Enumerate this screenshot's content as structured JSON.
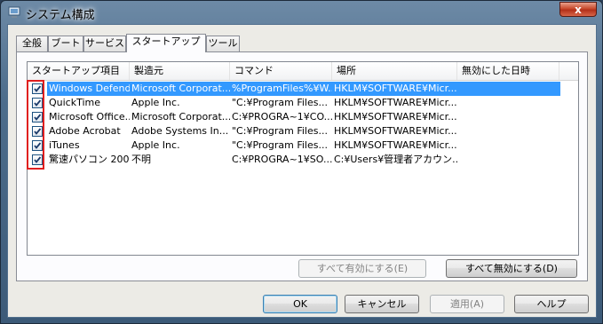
{
  "window": {
    "title": "システム構成",
    "close_label": "x"
  },
  "tabs": [
    {
      "label": "全般"
    },
    {
      "label": "ブート"
    },
    {
      "label": "サービス"
    },
    {
      "label": "スタートアップ"
    },
    {
      "label": "ツール"
    }
  ],
  "active_tab": "スタートアップ",
  "listview": {
    "columns": [
      "スタートアップ項目",
      "製造元",
      "コマンド",
      "場所",
      "無効にした日時"
    ],
    "rows": [
      {
        "checked": true,
        "selected": true,
        "item": "Windows Defend...",
        "maker": "Microsoft Corporat...",
        "command": "%ProgramFiles%¥W...",
        "location": "HKLM¥SOFTWARE¥Micr...",
        "disabled_date": ""
      },
      {
        "checked": true,
        "selected": false,
        "item": "QuickTime",
        "maker": "Apple Inc.",
        "command": "\"C:¥Program Files...",
        "location": "HKLM¥SOFTWARE¥Micr...",
        "disabled_date": ""
      },
      {
        "checked": true,
        "selected": false,
        "item": "Microsoft Office...",
        "maker": "Microsoft Corporat...",
        "command": "C:¥PROGRA~1¥CO...",
        "location": "HKLM¥SOFTWARE¥Micr...",
        "disabled_date": ""
      },
      {
        "checked": true,
        "selected": false,
        "item": "Adobe Acrobat",
        "maker": "Adobe Systems In...",
        "command": "\"C:¥Program Files...",
        "location": "HKLM¥SOFTWARE¥Micr...",
        "disabled_date": ""
      },
      {
        "checked": true,
        "selected": false,
        "item": "iTunes",
        "maker": "Apple Inc.",
        "command": "\"C:¥Program Files...",
        "location": "HKLM¥SOFTWARE¥Micr...",
        "disabled_date": ""
      },
      {
        "checked": true,
        "selected": false,
        "item": "驚速パソコン 200...",
        "maker": "不明",
        "command": "C:¥PROGRA~1¥SO...",
        "location": "C:¥Users¥管理者アカウン...",
        "disabled_date": ""
      }
    ]
  },
  "buttons": {
    "enable_all": "すべて有効にする(E)",
    "disable_all": "すべて無効にする(D)",
    "ok": "OK",
    "cancel": "キャンセル",
    "apply": "適用(A)",
    "help": "ヘルプ"
  },
  "colors": {
    "selection": "#3399ff",
    "highlight_annotation": "#e01f1f"
  }
}
